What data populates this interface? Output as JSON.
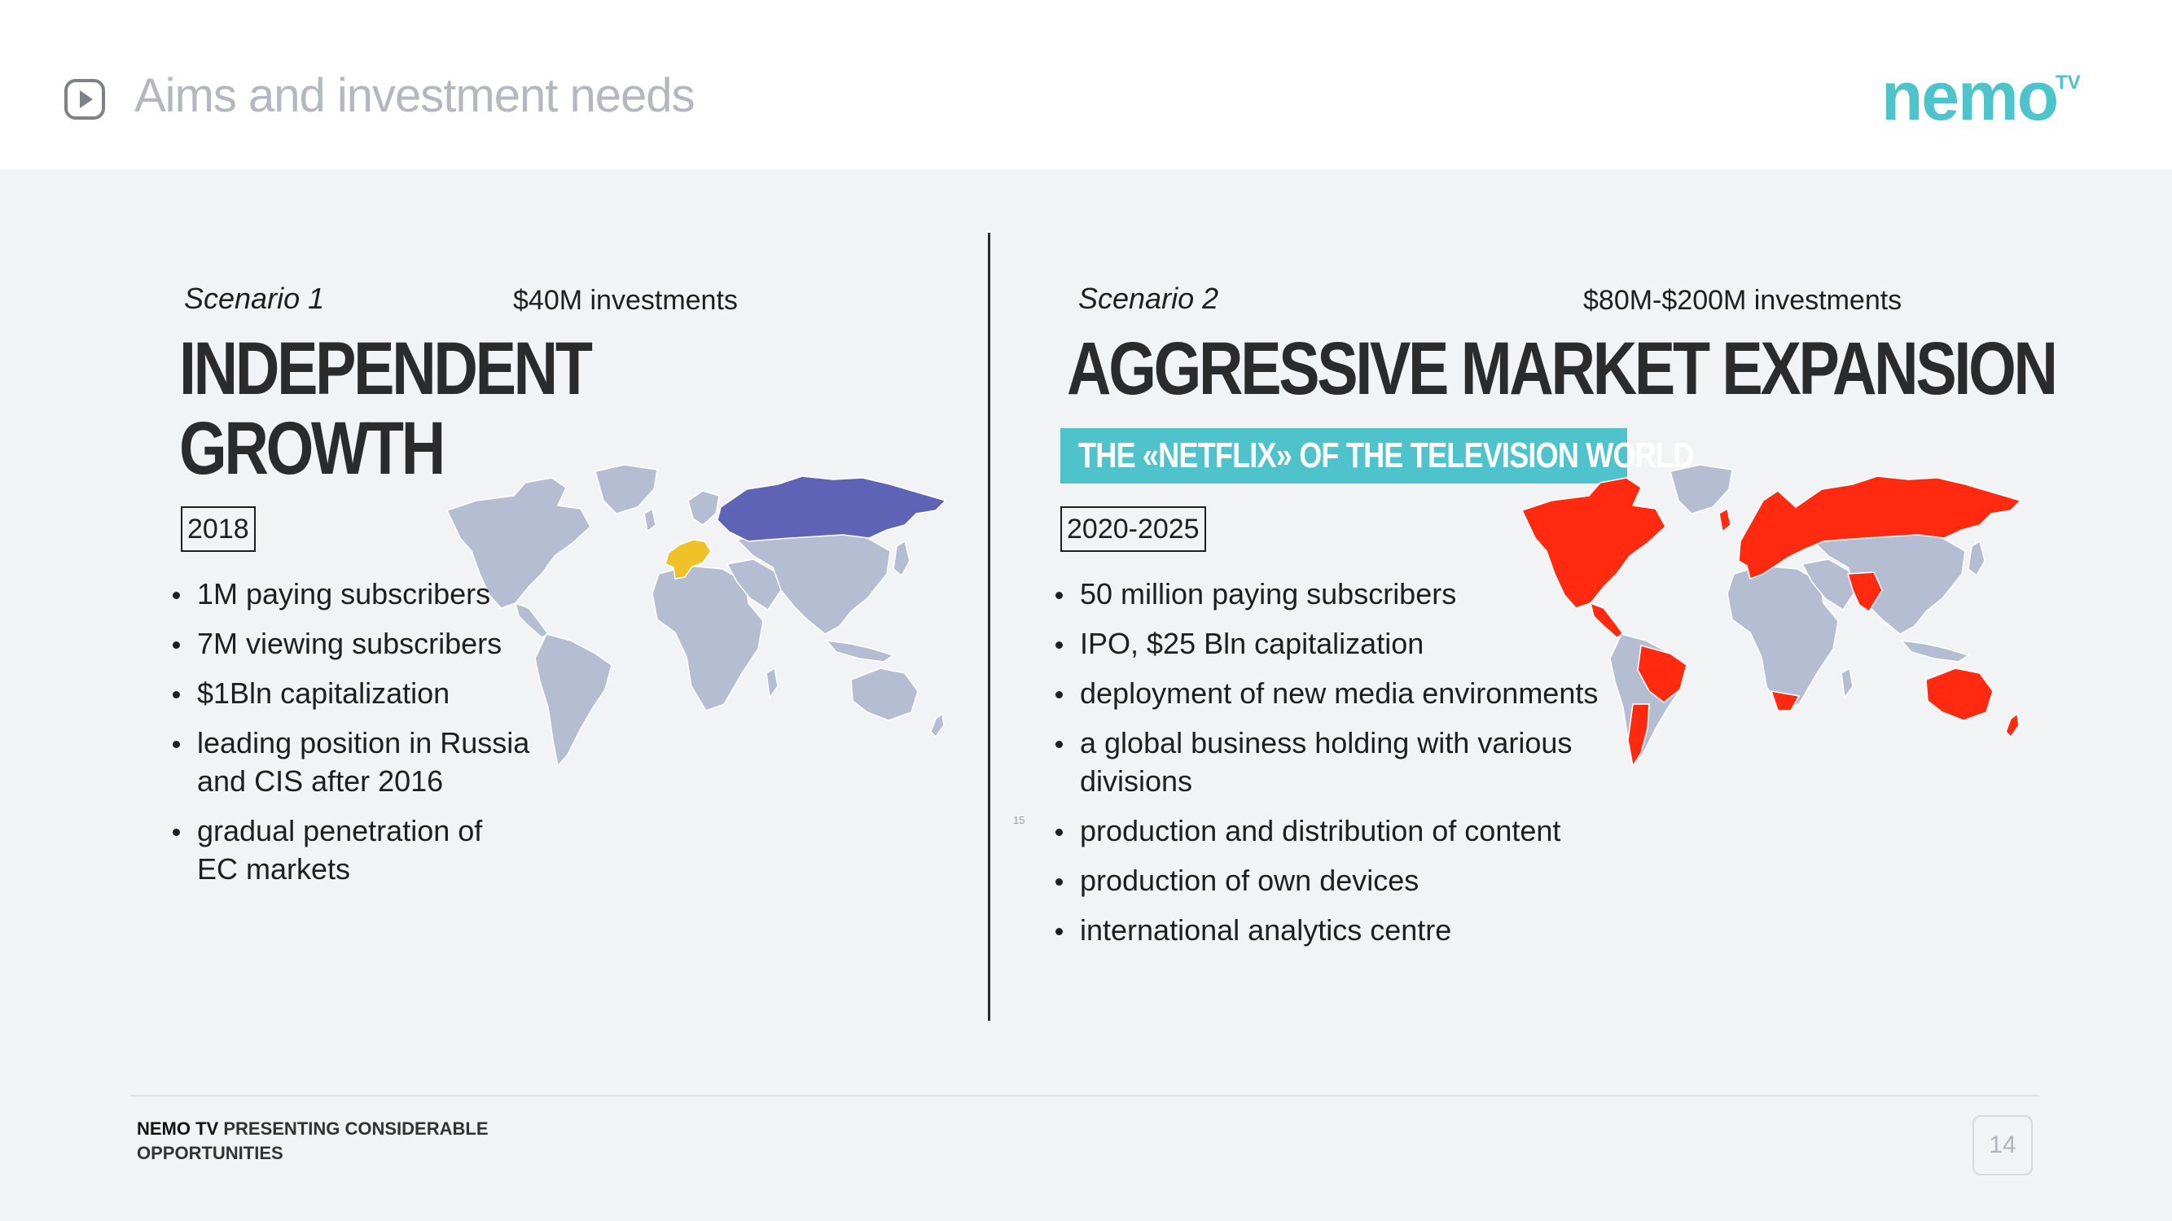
{
  "header": {
    "title": "Aims and investment needs",
    "logo": "nemo",
    "logo_superscript": "TV",
    "play_icon": "play-circle-icon"
  },
  "scenario1": {
    "label": "Scenario 1",
    "investment": "$40M investments",
    "heading_line1": "INDEPENDENT",
    "heading_line2": "GROWTH",
    "period": "2018",
    "bullets": [
      "1M paying subscribers",
      "7M viewing subscribers",
      "$1Bln capitalization",
      "leading position in Russia and CIS after 2016",
      "gradual penetration of EC markets"
    ],
    "map_colors": {
      "base": "#b4bdd2",
      "russia": "#5f63b5",
      "europe": "#f0c229"
    }
  },
  "scenario2": {
    "label": "Scenario 2",
    "investment": "$80M-$200M investments",
    "heading": "AGGRESSIVE MARKET EXPANSION",
    "tagline": "THE «NETFLIX» OF THE TELEVISION WORLD",
    "period": "2020-2025",
    "bullets": [
      "50 million paying subscribers",
      "IPO, $25 Bln capitalization",
      "deployment of new media environments",
      "a global business holding with various divisions",
      "production and distribution of content",
      "production of own devices",
      "international analytics centre"
    ],
    "map_colors": {
      "base": "#b4bdd2",
      "highlight": "#ff2a10"
    }
  },
  "small_number": "15",
  "footer": {
    "brand": "NEMO TV",
    "text": " PRESENTING CONSIDERABLE OPPORTUNITIES",
    "page_number": "14"
  },
  "colors": {
    "accent": "#4ec3cc",
    "background": "#f2f3f5"
  }
}
